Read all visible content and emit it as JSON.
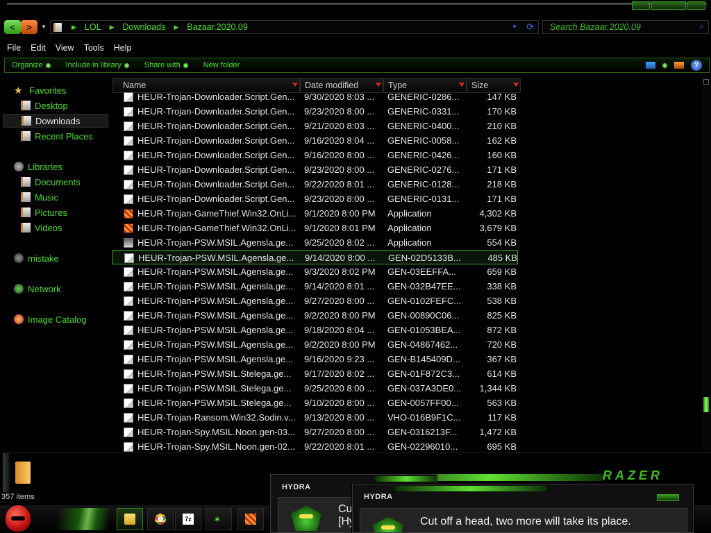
{
  "window": {
    "nav_back_glyph": "<",
    "nav_fwd_glyph": ">",
    "address": {
      "crumbs": [
        "LOL",
        "Downloads",
        "Bazaar.2020.09"
      ]
    },
    "search": {
      "placeholder": "Search Bazaar.2020.09"
    }
  },
  "menu": [
    "File",
    "Edit",
    "View",
    "Tools",
    "Help"
  ],
  "toolbar": {
    "organize": "Organize",
    "include": "Include in library",
    "share": "Share with",
    "newfolder": "New folder",
    "help_glyph": "?"
  },
  "sidebar": {
    "favorites": "Favorites",
    "desktop": "Desktop",
    "downloads": "Downloads",
    "recent": "Recent Places",
    "libraries": "Libraries",
    "documents": "Documents",
    "music": "Music",
    "pictures": "Pictures",
    "videos": "Videos",
    "mistake": "mistake",
    "network": "Network",
    "catalog": "Image Catalog"
  },
  "columns": {
    "name": "Name",
    "date": "Date modified",
    "type": "Type",
    "size": "Size"
  },
  "files": [
    {
      "name": "HEUR-Trojan-Downloader.Script.Gen...",
      "date": "9/30/2020 8:03 ...",
      "type": "GENERIC-0286...",
      "size": "147 KB",
      "icon": "doc"
    },
    {
      "name": "HEUR-Trojan-Downloader.Script.Gen...",
      "date": "9/23/2020 8:00 ...",
      "type": "GENERIC-0331...",
      "size": "170 KB",
      "icon": "doc"
    },
    {
      "name": "HEUR-Trojan-Downloader.Script.Gen...",
      "date": "9/21/2020 8:03 ...",
      "type": "GENERIC-0400...",
      "size": "210 KB",
      "icon": "doc"
    },
    {
      "name": "HEUR-Trojan-Downloader.Script.Gen...",
      "date": "9/16/2020 8:04 ...",
      "type": "GENERIC-0058...",
      "size": "162 KB",
      "icon": "doc"
    },
    {
      "name": "HEUR-Trojan-Downloader.Script.Gen...",
      "date": "9/16/2020 8:00 ...",
      "type": "GENERIC-0426...",
      "size": "160 KB",
      "icon": "doc"
    },
    {
      "name": "HEUR-Trojan-Downloader.Script.Gen...",
      "date": "9/23/2020 8:00 ...",
      "type": "GENERIC-0276...",
      "size": "171 KB",
      "icon": "doc"
    },
    {
      "name": "HEUR-Trojan-Downloader.Script.Gen...",
      "date": "9/22/2020 8:01 ...",
      "type": "GENERIC-0128...",
      "size": "218 KB",
      "icon": "doc"
    },
    {
      "name": "HEUR-Trojan-Downloader.Script.Gen...",
      "date": "9/23/2020 8:00 ...",
      "type": "GENERIC-0131...",
      "size": "171 KB",
      "icon": "doc"
    },
    {
      "name": "HEUR-Trojan-GameThief.Win32.OnLi...",
      "date": "9/1/2020 8:00 PM",
      "type": "Application",
      "size": "4,302 KB",
      "icon": "app"
    },
    {
      "name": "HEUR-Trojan-GameThief.Win32.OnLi...",
      "date": "9/1/2020 8:01 PM",
      "type": "Application",
      "size": "3,679 KB",
      "icon": "app"
    },
    {
      "name": "HEUR-Trojan-PSW.MSIL.Agensla.ge...",
      "date": "9/25/2020 8:02 ...",
      "type": "Application",
      "size": "554 KB",
      "icon": "app2"
    },
    {
      "name": "HEUR-Trojan-PSW.MSIL.Agensla.ge...",
      "date": "9/14/2020 8:00 ...",
      "type": "GEN-02D5133B...",
      "size": "485 KB",
      "icon": "doc",
      "selected": true
    },
    {
      "name": "HEUR-Trojan-PSW.MSIL.Agensla.ge...",
      "date": "9/3/2020 8:02 PM",
      "type": "GEN-03EEFFA...",
      "size": "659 KB",
      "icon": "doc"
    },
    {
      "name": "HEUR-Trojan-PSW.MSIL.Agensla.ge...",
      "date": "9/14/2020 8:01 ...",
      "type": "GEN-032B47EE...",
      "size": "338 KB",
      "icon": "doc"
    },
    {
      "name": "HEUR-Trojan-PSW.MSIL.Agensla.ge...",
      "date": "9/27/2020 8:00 ...",
      "type": "GEN-0102FEFC...",
      "size": "538 KB",
      "icon": "doc"
    },
    {
      "name": "HEUR-Trojan-PSW.MSIL.Agensla.ge...",
      "date": "9/2/2020 8:00 PM",
      "type": "GEN-00890C06...",
      "size": "825 KB",
      "icon": "doc"
    },
    {
      "name": "HEUR-Trojan-PSW.MSIL.Agensla.ge...",
      "date": "9/18/2020 8:04 ...",
      "type": "GEN-01053BEA...",
      "size": "872 KB",
      "icon": "doc"
    },
    {
      "name": "HEUR-Trojan-PSW.MSIL.Agensla.ge...",
      "date": "9/2/2020 8:00 PM",
      "type": "GEN-04867462...",
      "size": "720 KB",
      "icon": "doc"
    },
    {
      "name": "HEUR-Trojan-PSW.MSIL.Agensla.ge...",
      "date": "9/16/2020 9:23 ...",
      "type": "GEN-B145409D...",
      "size": "367 KB",
      "icon": "doc"
    },
    {
      "name": "HEUR-Trojan-PSW.MSIL.Stelega.ge...",
      "date": "9/17/2020 8:02 ...",
      "type": "GEN-01F872C3...",
      "size": "614 KB",
      "icon": "doc"
    },
    {
      "name": "HEUR-Trojan-PSW.MSIL.Stelega.ge...",
      "date": "9/25/2020 8:00 ...",
      "type": "GEN-037A3DE0...",
      "size": "1,344 KB",
      "icon": "doc"
    },
    {
      "name": "HEUR-Trojan-PSW.MSIL.Stelega.ge...",
      "date": "9/10/2020 8:00 ...",
      "type": "GEN-0057FF00...",
      "size": "563 KB",
      "icon": "doc"
    },
    {
      "name": "HEUR-Trojan-Ransom.Win32.Sodin.v...",
      "date": "9/13/2020 8:00 ...",
      "type": "VHO-016B9F1C...",
      "size": "117 KB",
      "icon": "doc"
    },
    {
      "name": "HEUR-Trojan-Spy.MSIL.Noon.gen-03...",
      "date": "9/27/2020 8:00 ...",
      "type": "GEN-0316213F...",
      "size": "1,472 KB",
      "icon": "doc"
    },
    {
      "name": "HEUR-Trojan-Spy.MSIL.Noon.gen-02...",
      "date": "9/22/2020 8:01 ...",
      "type": "GEN-02296010...",
      "size": "695 KB",
      "icon": "doc"
    }
  ],
  "status": {
    "item_count": "357 items"
  },
  "details_logo": "RAZER",
  "taskbar": {
    "sevenzip_label": "7z"
  },
  "popups": {
    "back": {
      "title": "HYDRA",
      "msg_line1": "Cu",
      "msg_line2": "[Hy"
    },
    "front": {
      "title": "HYDRA",
      "message": "Cut off a head, two more will take its place."
    }
  },
  "colors": {
    "accent_green": "#4cdc2a",
    "selection_border": "#4aa03a",
    "sort_arrow": "#dd2222"
  },
  "icons": {
    "folder": "folder-icon",
    "document": "document-icon",
    "application": "application-icon",
    "search": "search-icon",
    "refresh": "refresh-icon",
    "help": "help-icon"
  }
}
